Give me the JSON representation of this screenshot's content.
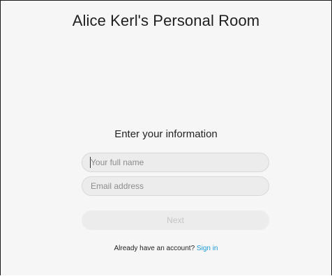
{
  "header": {
    "room_title": "Alice Kerl's Personal Room"
  },
  "form": {
    "heading": "Enter your information",
    "name_placeholder": "Your full name",
    "email_placeholder": "Email address",
    "next_label": "Next"
  },
  "footer": {
    "prompt": "Already have an account?",
    "sign_in_label": "Sign in"
  },
  "colors": {
    "link": "#1a9ad6",
    "field_background": "#ececec",
    "page_background": "#f6f6f6"
  }
}
